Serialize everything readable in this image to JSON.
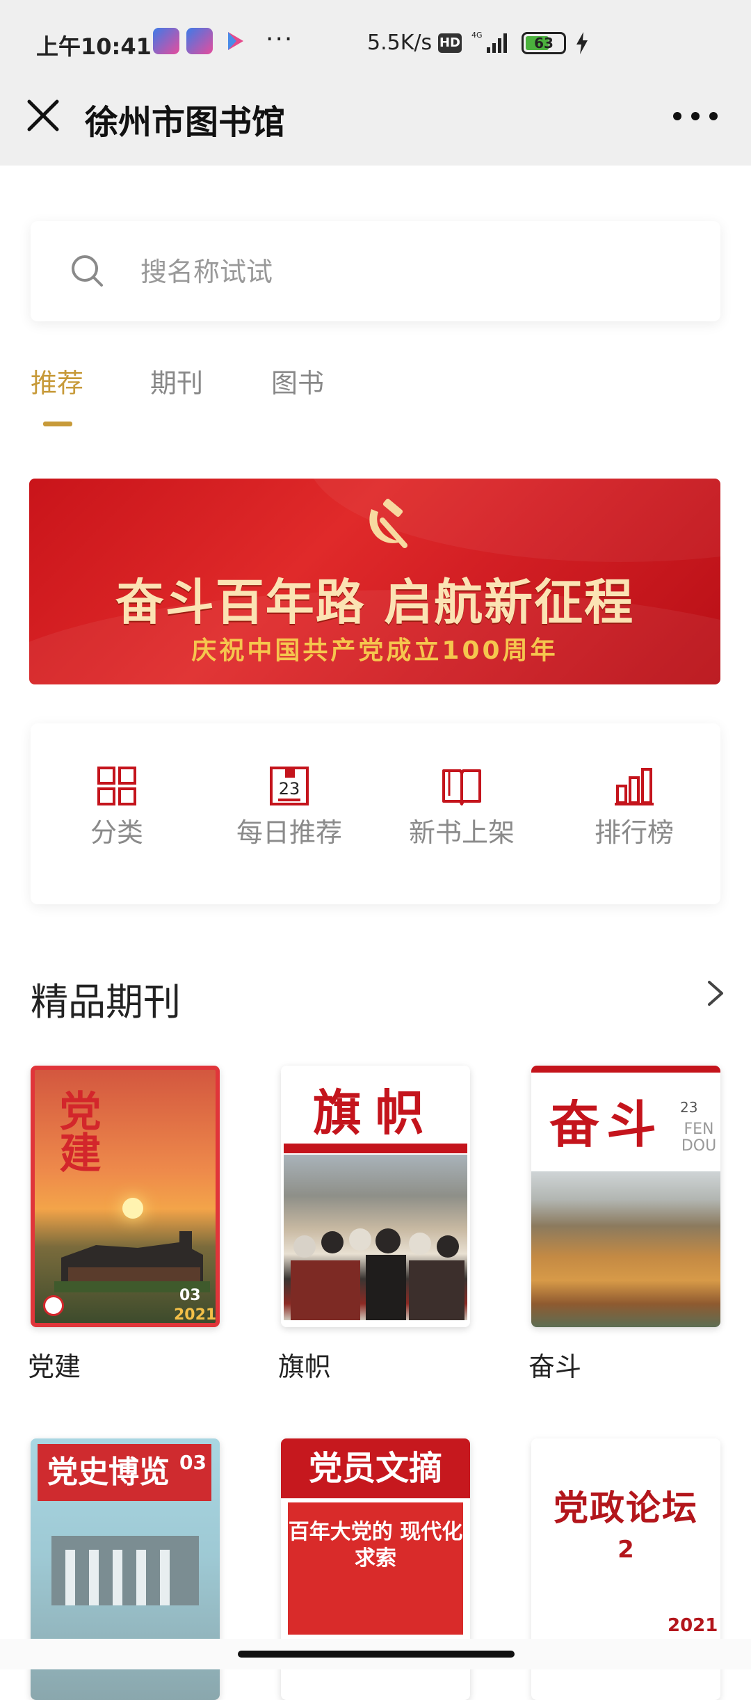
{
  "status_bar": {
    "time": "上午10:41",
    "dots": "···",
    "net_speed": "5.5K/s",
    "hd": "HD",
    "battery": "63",
    "battery_level": 0.63
  },
  "title_bar": {
    "title": "徐州市图书馆",
    "close_icon": "close-icon",
    "menu_icon": "more-horizontal-icon"
  },
  "search": {
    "placeholder": "搜名称试试",
    "value": ""
  },
  "tabs": [
    {
      "label": "推荐",
      "active": true
    },
    {
      "label": "期刊",
      "active": false
    },
    {
      "label": "图书",
      "active": false
    }
  ],
  "banner": {
    "slogan": "奋斗百年路 启航新征程",
    "subtitle": "庆祝中国共产党成立100周年"
  },
  "quick_nav": [
    {
      "label": "分类",
      "icon": "grid-icon"
    },
    {
      "label": "每日推荐",
      "icon": "calendar-icon",
      "badge": "23"
    },
    {
      "label": "新书上架",
      "icon": "book-open-icon"
    },
    {
      "label": "排行榜",
      "icon": "bar-chart-icon"
    }
  ],
  "section": {
    "title": "精品期刊",
    "arrow_icon": "chevron-right-icon"
  },
  "journals": [
    {
      "name": "党建",
      "cover_title": "党建",
      "cover_num": "03",
      "cover_year": "2021"
    },
    {
      "name": "旗帜",
      "cover_title": "旗帜"
    },
    {
      "name": "奋斗",
      "cover_title": "奋斗",
      "cover_num": "23",
      "cover_sub": "FEN DOU"
    },
    {
      "name": "",
      "cover_title": "党史博览",
      "cover_num": "03"
    },
    {
      "name": "",
      "cover_title": "党员文摘",
      "cover_headline": "百年大党的 现代化求索"
    },
    {
      "name": "",
      "cover_title": "党政论坛",
      "cover_num": "2",
      "cover_year": "2021"
    }
  ],
  "colors": {
    "accent": "#c79a39",
    "brand_red": "#c4141c",
    "icon_red": "#c4141c"
  }
}
